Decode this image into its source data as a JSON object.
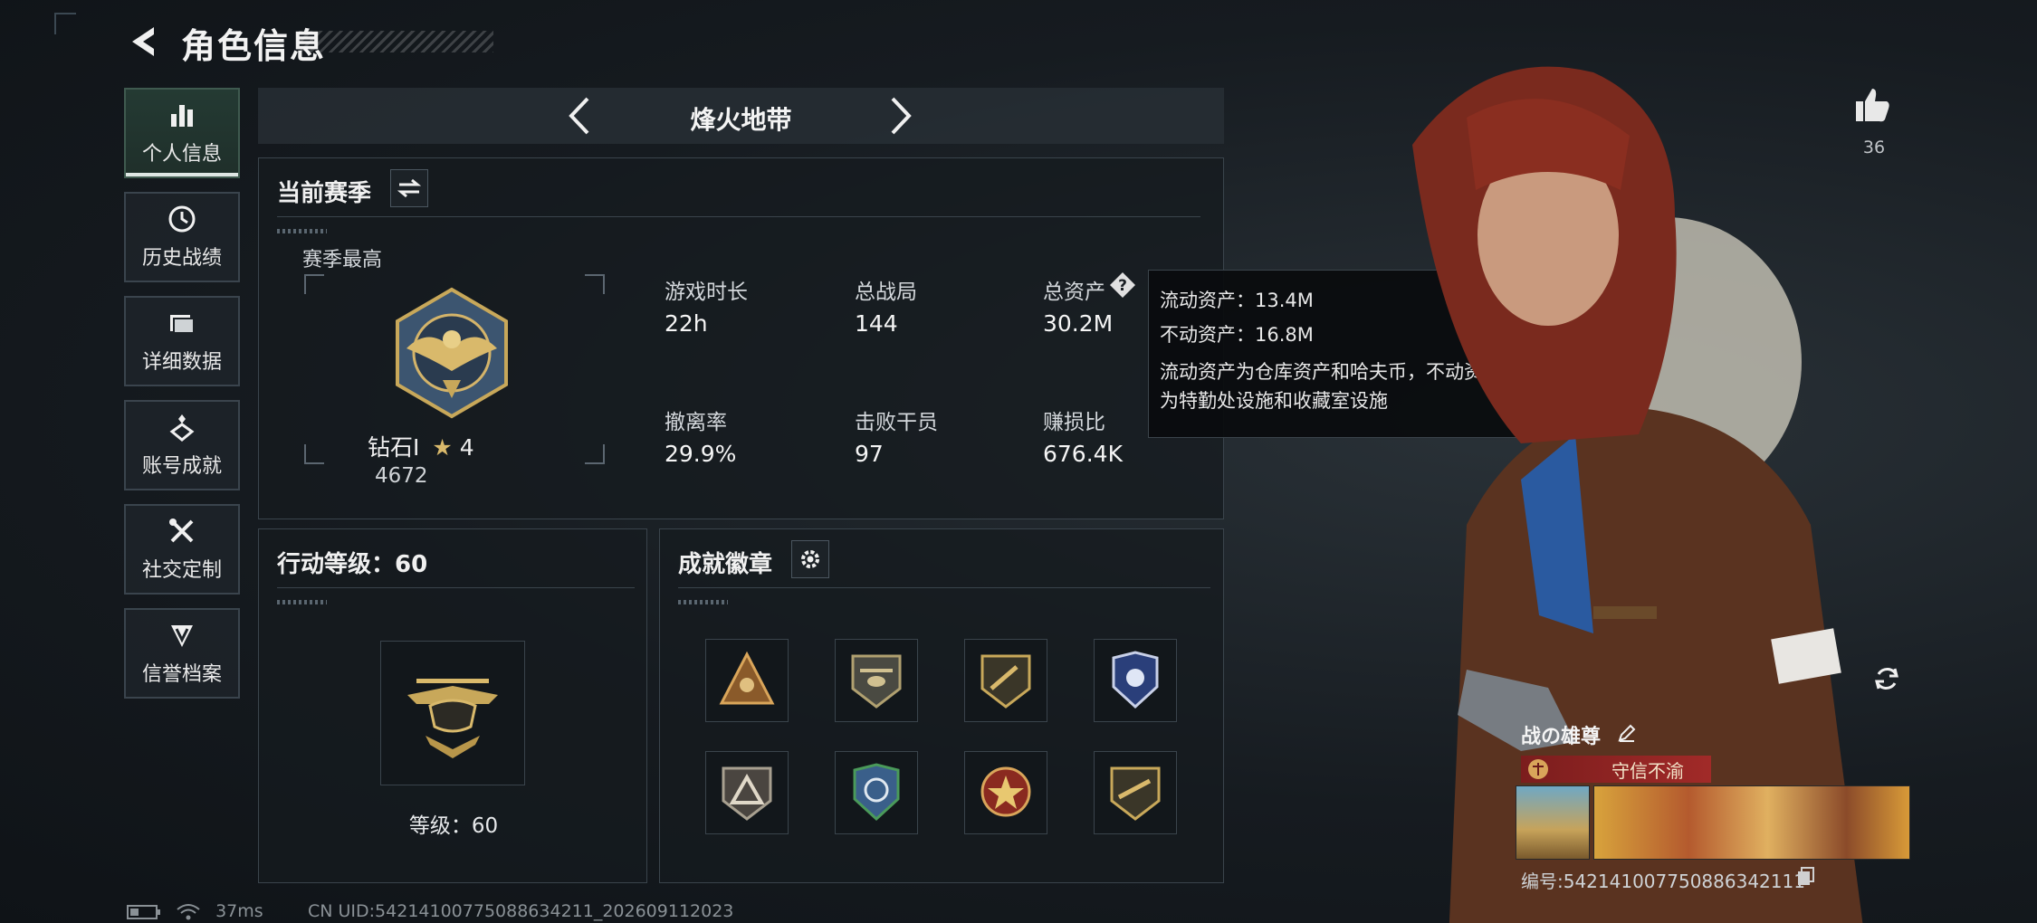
{
  "header": {
    "title": "角色信息"
  },
  "sidebar": {
    "items": [
      {
        "label": "个人信息",
        "icon": "bar-chart-icon",
        "active": true
      },
      {
        "label": "历史战绩",
        "icon": "history-icon"
      },
      {
        "label": "详细数据",
        "icon": "folder-icon"
      },
      {
        "label": "账号成就",
        "icon": "achievement-icon"
      },
      {
        "label": "社交定制",
        "icon": "tools-icon"
      },
      {
        "label": "信誉档案",
        "icon": "shield-v-icon"
      }
    ]
  },
  "mode": {
    "label": "烽火地带"
  },
  "season": {
    "title": "当前赛季",
    "best_label": "赛季最高",
    "rank_name": "钻石Ⅰ",
    "rank_stars": "4",
    "rank_score": "4672",
    "stats": [
      {
        "label": "游戏时长",
        "value": "22h"
      },
      {
        "label": "总战局",
        "value": "144"
      },
      {
        "label": "总资产",
        "value": "30.2M"
      },
      {
        "label": "撤离率",
        "value": "29.9%"
      },
      {
        "label": "击败干员",
        "value": "97"
      },
      {
        "label": "赚损比",
        "value": "676.4K"
      }
    ]
  },
  "tooltip": {
    "line1": "流动资产：13.4M",
    "line2": "不动资产：16.8M",
    "desc1": "流动资产为仓库资产和哈夫币，不动资产",
    "desc2": "为特勤处设施和收藏室设施"
  },
  "action_level": {
    "title": "行动等级：60",
    "level_label": "等级：60"
  },
  "badges": {
    "title": "成就徽章",
    "items": [
      "badge-1",
      "badge-2",
      "badge-3",
      "badge-4",
      "badge-5",
      "badge-6",
      "badge-7",
      "badge-8"
    ]
  },
  "profile": {
    "likes": "36",
    "name": "战の雄尊",
    "motto": "守信不渝",
    "uid_line": "编号:542141007750886342111"
  },
  "status": {
    "ping": "37ms",
    "cn_uid": "CN UID:542141007750886342​11_202609112023"
  },
  "colors": {
    "accent": "#3f5a4f",
    "panel_border": "#3a444c",
    "motto_red": "#a12a28"
  }
}
